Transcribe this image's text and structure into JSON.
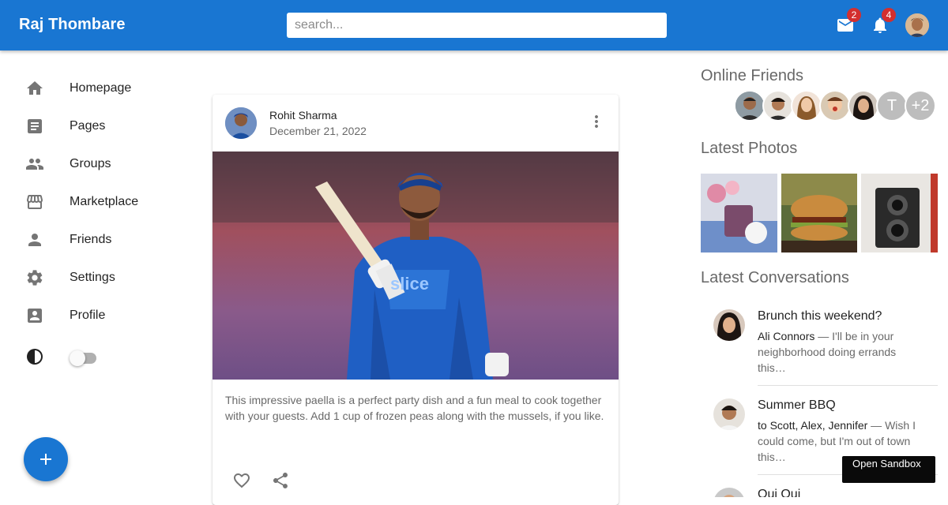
{
  "header": {
    "brand": "Raj Thombare",
    "search_placeholder": "search...",
    "mail_badge": "2",
    "notif_badge": "4",
    "bar_color": "#1976d2"
  },
  "sidebar": {
    "items": [
      {
        "label": "Homepage",
        "icon": "home-icon"
      },
      {
        "label": "Pages",
        "icon": "article-icon"
      },
      {
        "label": "Groups",
        "icon": "group-icon"
      },
      {
        "label": "Marketplace",
        "icon": "storefront-icon"
      },
      {
        "label": "Friends",
        "icon": "person-icon"
      },
      {
        "label": "Settings",
        "icon": "gear-icon"
      },
      {
        "label": "Profile",
        "icon": "account-box-icon"
      }
    ],
    "dark_mode": false
  },
  "post": {
    "author": "Rohit Sharma",
    "date": "December 21, 2022",
    "text": "This impressive paella is a perfect party dish and a fun meal to cook together with your guests. Add 1 cup of frozen peas along with the mussels, if you like."
  },
  "right": {
    "online_title": "Online Friends",
    "online_letter": "T",
    "online_more": "+2",
    "photos_title": "Latest Photos",
    "conversations_title": "Latest Conversations",
    "conversations": [
      {
        "title": "Brunch this weekend?",
        "who": "Ali Connors",
        "snippet": " — I'll be in your neighborhood doing errands this…"
      },
      {
        "title": "Summer BBQ",
        "who": "to Scott, Alex, Jennifer",
        "snippet": " — Wish I could come, but I'm out of town this…"
      },
      {
        "title": "Oui Oui",
        "who": "",
        "snippet": ""
      }
    ]
  },
  "sandbox_label": "Open Sandbox"
}
